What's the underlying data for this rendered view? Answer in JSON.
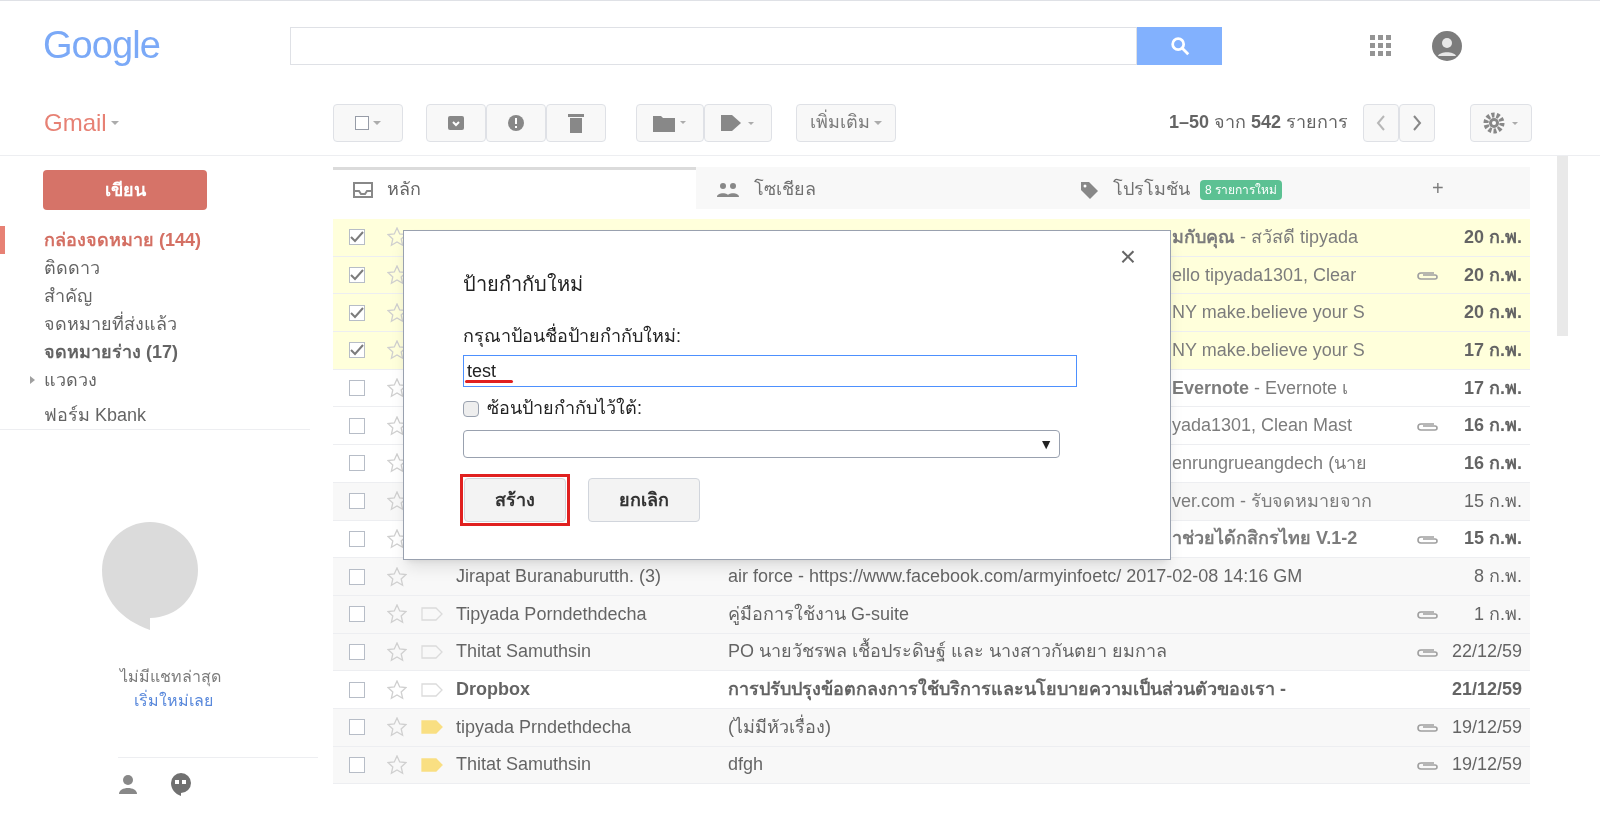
{
  "header": {
    "logo": "Google"
  },
  "app_label": "Gmail",
  "toolbar": {
    "more_button": "เพิ่มเติม",
    "page_info": "**1–50** จาก **542** รายการ"
  },
  "sidebar": {
    "compose": "เขียน",
    "items": [
      {
        "label": "กล่องจดหมาย (144)",
        "selected": true,
        "unread": true
      },
      {
        "label": "ติดดาว",
        "selected": false,
        "unread": false
      },
      {
        "label": "สำคัญ",
        "selected": false,
        "unread": false
      },
      {
        "label": "จดหมายที่ส่งแล้ว",
        "selected": false,
        "unread": false
      },
      {
        "label": "จดหมายร่าง (17)",
        "selected": false,
        "unread": true
      },
      {
        "label": "แวดวง",
        "selected": false,
        "unread": false,
        "expanded": false
      },
      {
        "label": "ฟอร์ม Kbank",
        "selected": false,
        "unread": false
      }
    ],
    "chat": {
      "empty": "ไม่มีแชทล่าสุด",
      "start_link": "เริ่มใหม่เลย"
    }
  },
  "tabs": [
    {
      "label": "หลัก",
      "selected": true,
      "kind": "inbox"
    },
    {
      "label": "โซเชียล",
      "selected": false,
      "kind": "people"
    },
    {
      "label": "โปรโมชัน",
      "selected": false,
      "kind": "tag",
      "badge": "8 รายการใหม่"
    }
  ],
  "add_tab": "+",
  "emails": [
    {
      "kind": "covered",
      "checked": true,
      "starred": false,
      "unread": true,
      "attachment": false,
      "snippet": "**มกับคุณ** - สวัสดี tipyada",
      "date": "20 ก.พ."
    },
    {
      "kind": "covered",
      "checked": true,
      "starred": false,
      "unread": true,
      "attachment": true,
      "snippet": "ello tipyada1301, Clear",
      "date": "20 ก.พ."
    },
    {
      "kind": "covered",
      "checked": true,
      "starred": false,
      "unread": true,
      "attachment": false,
      "snippet": "NY make.believe your S",
      "date": "20 ก.พ."
    },
    {
      "kind": "covered",
      "checked": true,
      "starred": false,
      "unread": true,
      "attachment": false,
      "snippet": "NY make.believe your S",
      "date": "17 ก.พ."
    },
    {
      "kind": "covered",
      "checked": false,
      "starred": false,
      "unread": true,
      "attachment": false,
      "snippet": "**Evernote** - Evernote เ",
      "date": "17 ก.พ."
    },
    {
      "kind": "covered",
      "checked": false,
      "starred": false,
      "unread": true,
      "attachment": true,
      "snippet": "yada1301, Clean Mast",
      "date": "16 ก.พ."
    },
    {
      "kind": "covered",
      "checked": false,
      "starred": false,
      "unread": true,
      "attachment": false,
      "snippet": "enrungrueangdech (นาย",
      "date": "16 ก.พ."
    },
    {
      "kind": "covered",
      "checked": false,
      "starred": false,
      "unread": false,
      "attachment": false,
      "snippet": "ver.com - รับจดหมายจาก",
      "date": "15 ก.พ."
    },
    {
      "kind": "covered",
      "checked": false,
      "starred": false,
      "unread": true,
      "attachment": true,
      "snippet": "**าช่วยได้กสิกรไทย V.1-2**",
      "date": "15 ก.พ."
    },
    {
      "kind": "full",
      "checked": false,
      "starred": false,
      "unread": false,
      "attachment": false,
      "sender": "Jirapat Buranaburutth. (3)",
      "subject": "air force - https://www.facebook.com/armyinfoetc/ 2017-02-08 14:16 GM",
      "date": "8 ก.พ."
    },
    {
      "kind": "full",
      "checked": false,
      "starred": false,
      "unread": false,
      "important": false,
      "attachment": true,
      "sender": "Tipyada Porndethdecha",
      "subject": "คู่มือการใช้งาน G-suite",
      "date": "1 ก.พ."
    },
    {
      "kind": "full",
      "checked": false,
      "starred": false,
      "unread": false,
      "important": false,
      "attachment": true,
      "sender": "Thitat Samuthsin",
      "subject": "PO นายวัชรพล เชื้อประดิษฐ์ และ นางสาวกันตยา ยมกาล",
      "date": "22/12/59"
    },
    {
      "kind": "full",
      "checked": false,
      "starred": false,
      "unread": true,
      "important": false,
      "attachment": false,
      "sender": "Dropbox",
      "subject": "การปรับปรุงข้อตกลงการใช้บริการและนโยบายความเป็นส่วนตัวของเรา -",
      "date": "21/12/59"
    },
    {
      "kind": "full",
      "checked": false,
      "starred": false,
      "unread": false,
      "important": true,
      "attachment": true,
      "sender": "tipyada Prndethdecha",
      "subject": "(ไม่มีหัวเรื่อง)",
      "date": "19/12/59"
    },
    {
      "kind": "full",
      "checked": false,
      "starred": false,
      "unread": false,
      "important": true,
      "attachment": true,
      "sender": "Thitat Samuthsin",
      "subject": "dfgh",
      "date": "19/12/59"
    }
  ],
  "dialog": {
    "title": "ป้ายกำกับใหม่",
    "close": "×",
    "prompt": "กรุณาป้อนชื่อป้ายกำกับใหม่:",
    "name_value": "test",
    "value_underlined": true,
    "nest": {
      "label": "ซ้อนป้ายกำกับไว้ใต้:",
      "checked": false
    },
    "parent_caret": "▼",
    "buttons": [
      {
        "label": "สร้าง",
        "highlighted": true
      },
      {
        "label": "ยกเลิก",
        "highlighted": false
      }
    ]
  }
}
